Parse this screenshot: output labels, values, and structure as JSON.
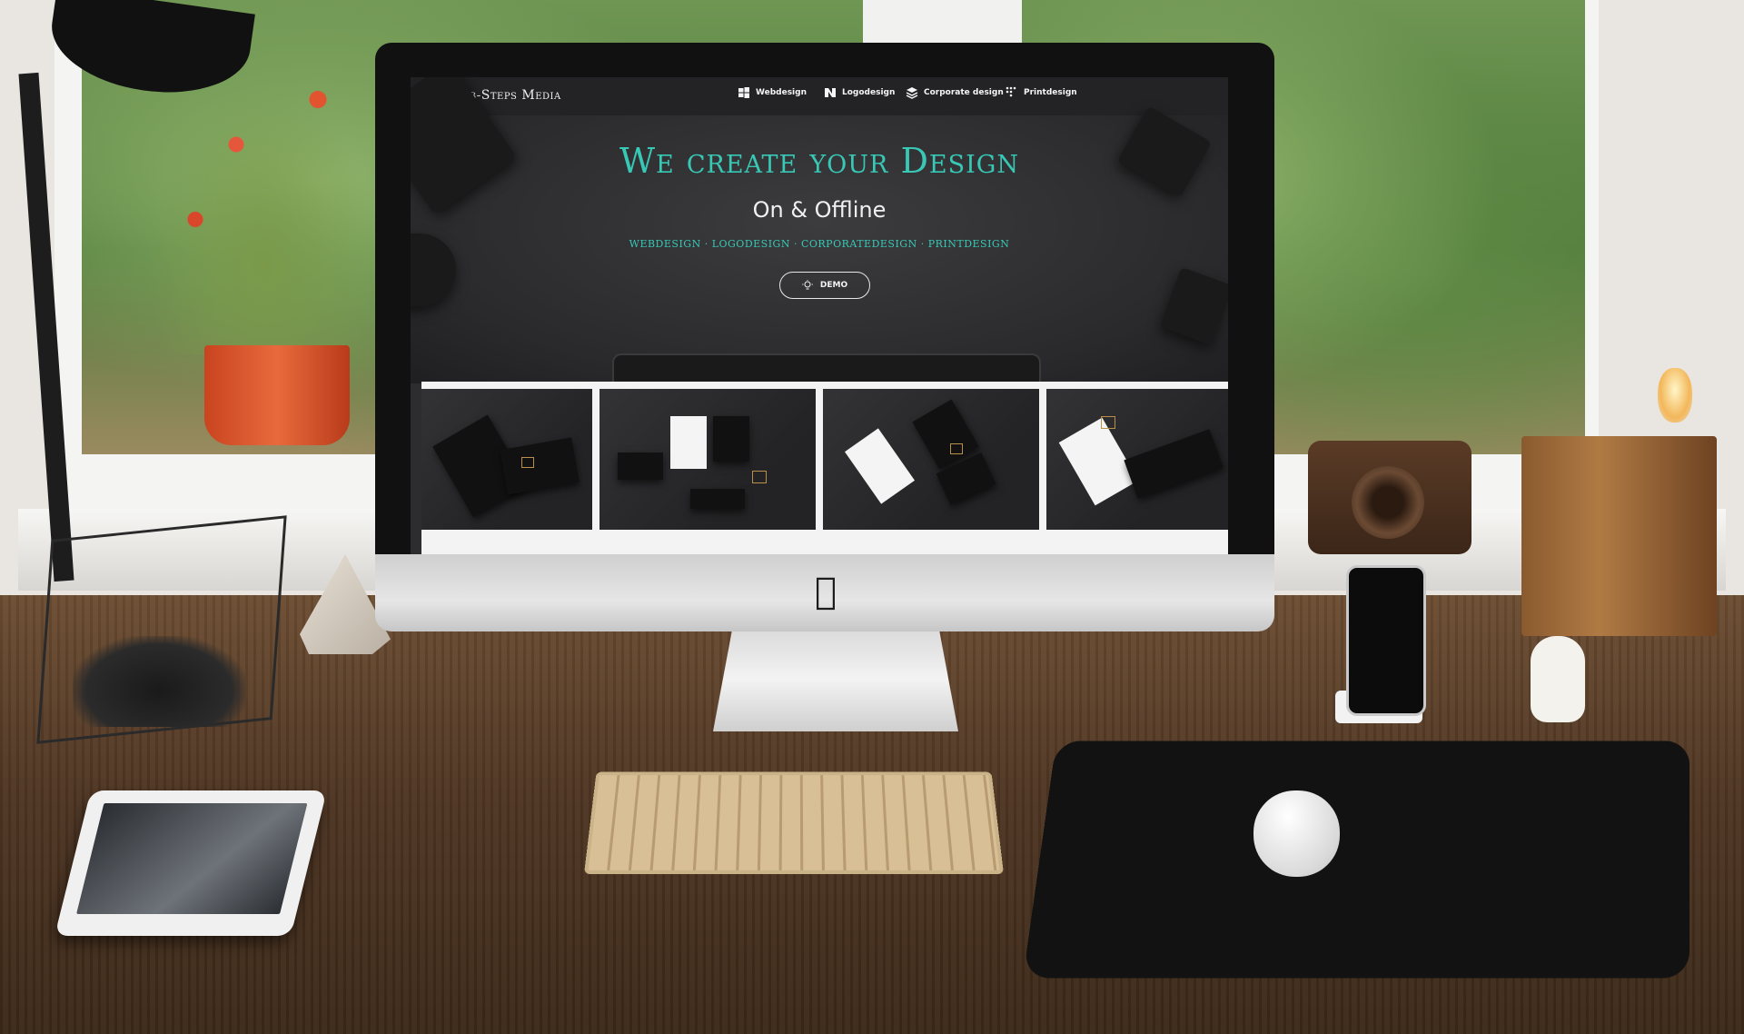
{
  "website": {
    "brand": "Web-Steps Media",
    "nav": [
      {
        "label": "Webdesign",
        "icon": "windows-icon"
      },
      {
        "label": "Logodesign",
        "icon": "logo-icon"
      },
      {
        "label": "Corporate design",
        "icon": "layers-icon"
      },
      {
        "label": "Printdesign",
        "icon": "grid-dots-icon"
      }
    ],
    "hero": {
      "title": "We create your Design",
      "subtitle": "On & Offline",
      "services": "WEBDESIGN · LOGODESIGN · CORPORATEDESIGN · PRINTDESIGN",
      "demo_label": "DEMO"
    },
    "gallery_count": 4,
    "accent_color": "#38c8b6",
    "background_color": "#2d2d2f"
  }
}
